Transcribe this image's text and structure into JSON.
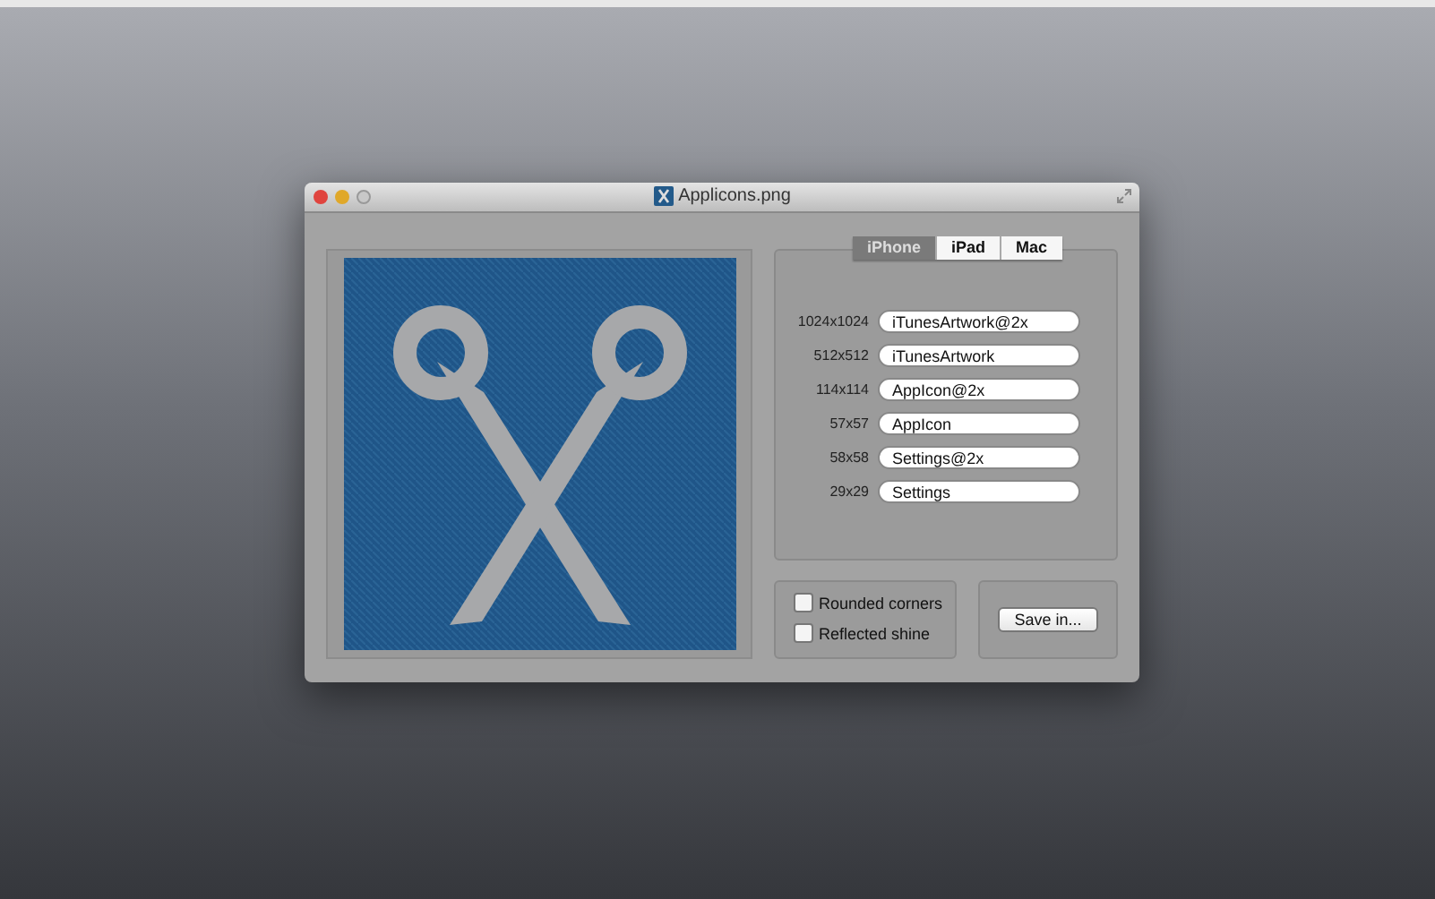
{
  "window": {
    "title": "Applicons.png"
  },
  "tabs": [
    {
      "label": "iPhone",
      "selected": true
    },
    {
      "label": "iPad",
      "selected": false
    },
    {
      "label": "Mac",
      "selected": false
    }
  ],
  "sizes": [
    {
      "size": "1024x1024",
      "name": "iTunesArtwork@2x"
    },
    {
      "size": "512x512",
      "name": "iTunesArtwork"
    },
    {
      "size": "114x114",
      "name": "AppIcon@2x"
    },
    {
      "size": "57x57",
      "name": "AppIcon"
    },
    {
      "size": "58x58",
      "name": "Settings@2x"
    },
    {
      "size": "29x29",
      "name": "Settings"
    }
  ],
  "options": [
    {
      "label": "Rounded corners",
      "checked": false
    },
    {
      "label": "Reflected shine",
      "checked": false
    }
  ],
  "save_button": "Save in..."
}
